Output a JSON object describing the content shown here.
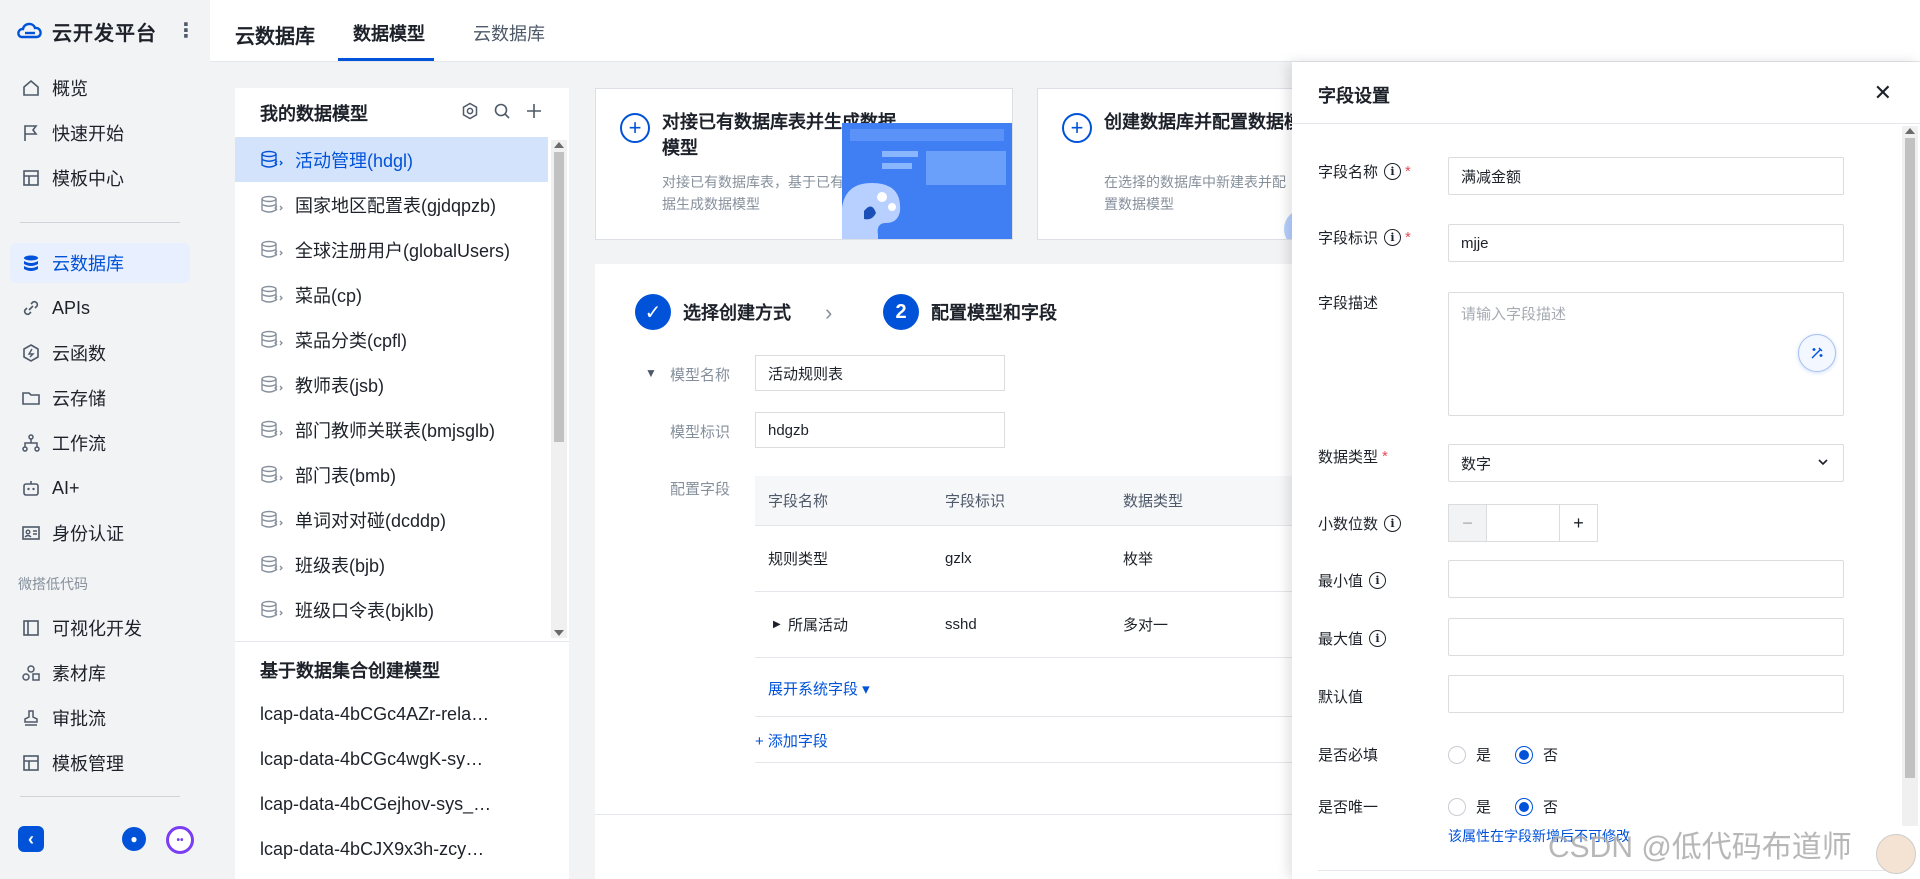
{
  "brand": {
    "title": "云开发平台"
  },
  "nav": {
    "items": [
      {
        "label": "概览",
        "icon": "home-icon"
      },
      {
        "label": "快速开始",
        "icon": "flag-icon"
      },
      {
        "label": "模板中心",
        "icon": "template-icon"
      }
    ],
    "items2": [
      {
        "label": "云数据库",
        "icon": "database-icon",
        "active": true
      },
      {
        "label": "APIs",
        "icon": "link-icon"
      },
      {
        "label": "云函数",
        "icon": "function-icon"
      },
      {
        "label": "云存储",
        "icon": "folder-icon"
      },
      {
        "label": "工作流",
        "icon": "workflow-icon"
      },
      {
        "label": "AI+",
        "icon": "robot-icon"
      },
      {
        "label": "身份认证",
        "icon": "id-card-icon"
      }
    ],
    "group_label": "微搭低代码",
    "items3": [
      {
        "label": "可视化开发",
        "icon": "layout-icon"
      },
      {
        "label": "素材库",
        "icon": "assets-icon"
      },
      {
        "label": "审批流",
        "icon": "stamp-icon"
      },
      {
        "label": "模板管理",
        "icon": "template-manage-icon"
      }
    ]
  },
  "topbar": {
    "title": "云数据库",
    "tabs": [
      {
        "label": "数据模型",
        "active": true
      },
      {
        "label": "云数据库",
        "active": false
      }
    ]
  },
  "model_panel": {
    "title": "我的数据模型",
    "models": [
      "活动管理(hdgl)",
      "国家地区配置表(gjdqpzb)",
      "全球注册用户(globalUsers)",
      "菜品(cp)",
      "菜品分类(cpfl)",
      "教师表(jsb)",
      "部门教师关联表(bmjsglb)",
      "部门表(bmb)",
      "单词对对碰(dcddp)",
      "班级表(bjb)",
      "班级口令表(bjklb)"
    ],
    "dataset_title": "基于数据集合创建模型",
    "datasets": [
      "lcap-data-4bCGc4AZr-rela…",
      "lcap-data-4bCGc4wgK-sy…",
      "lcap-data-4bCGejhov-sys_…",
      "lcap-data-4bCJX9x3h-zcy…"
    ]
  },
  "cards": [
    {
      "title": "对接已有数据库表并生成数据模型",
      "desc": "对接已有数据库表，基于已有的数据生成数据模型"
    },
    {
      "title": "创建数据库并配置数据模",
      "desc": "在选择的数据库中新建表并配置数据模型"
    }
  ],
  "steps": [
    {
      "label": "选择创建方式",
      "marker": "✓"
    },
    {
      "label": "配置模型和字段",
      "marker": "2"
    }
  ],
  "form": {
    "model_name_label": "模型名称",
    "model_name": "活动规则表",
    "model_id_label": "模型标识",
    "model_id": "hdgzb",
    "fields_label": "配置字段",
    "columns": [
      "字段名称",
      "字段标识",
      "数据类型"
    ],
    "rows": [
      {
        "name": "规则类型",
        "id": "gzlx",
        "type": "枚举"
      },
      {
        "name": "所属活动",
        "id": "sshd",
        "type": "多对一"
      }
    ],
    "expand_link": "展开系统字段 ▾",
    "add_field": "+ 添加字段"
  },
  "drawer": {
    "title": "字段设置",
    "field_name_label": "字段名称",
    "field_name": "满减金额",
    "field_id_label": "字段标识",
    "field_id": "mjje",
    "field_desc_label": "字段描述",
    "field_desc_placeholder": "请输入字段描述",
    "data_type_label": "数据类型",
    "data_type": "数字",
    "decimals_label": "小数位数",
    "min_label": "最小值",
    "max_label": "最大值",
    "default_label": "默认值",
    "required_label": "是否必填",
    "unique_label": "是否唯一",
    "yes": "是",
    "no": "否",
    "required_value": "否",
    "unique_value": "否",
    "unique_hint": "该属性在字段新增后不可修改"
  },
  "watermark": "CSDN @低代码布道师",
  "colors": {
    "accent": "#0052d9",
    "active_bg": "#d4e3fc",
    "required": "#e34d59"
  }
}
